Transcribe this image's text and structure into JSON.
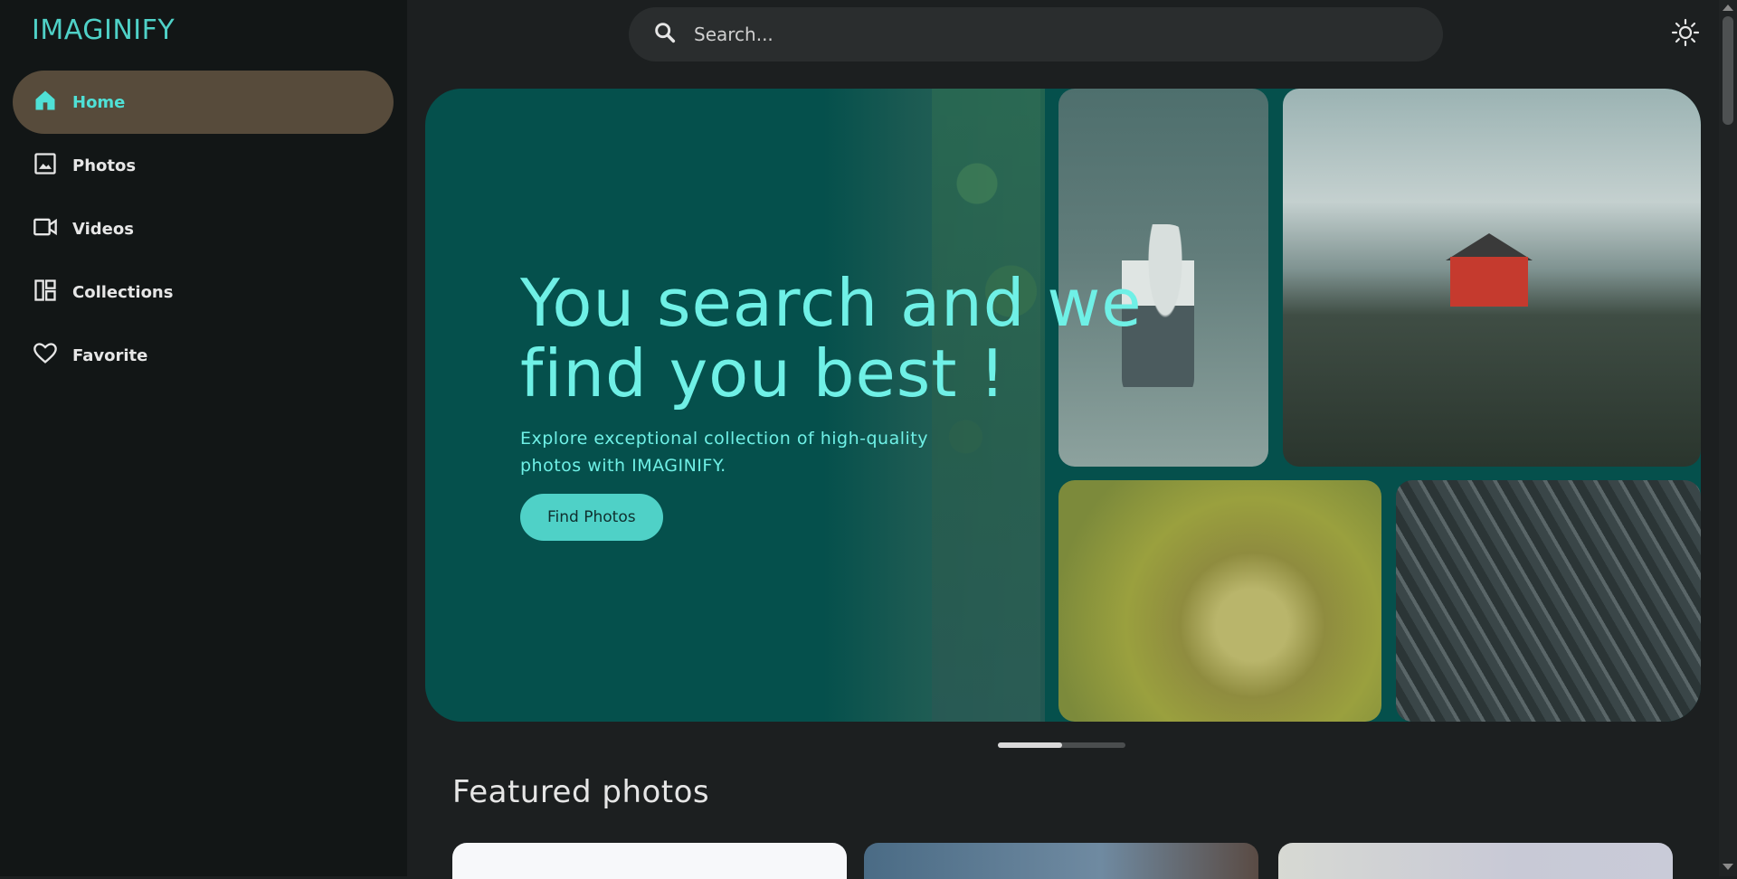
{
  "app": {
    "brand": "IMAGINIFY"
  },
  "sidebar": {
    "items": [
      {
        "label": "Home",
        "icon": "home-icon",
        "active": true
      },
      {
        "label": "Photos",
        "icon": "image-icon",
        "active": false
      },
      {
        "label": "Videos",
        "icon": "video-icon",
        "active": false
      },
      {
        "label": "Collections",
        "icon": "collections-icon",
        "active": false
      },
      {
        "label": "Favorite",
        "icon": "heart-icon",
        "active": false
      }
    ]
  },
  "header": {
    "search_placeholder": "Search...",
    "theme_icon": "sun-icon"
  },
  "hero": {
    "title": "You search and we find you best !",
    "subtitle": "Explore exceptional collection of high-quality photos with IMAGINIFY.",
    "button_label": "Find Photos",
    "slider_progress": 0.5
  },
  "featured": {
    "title": "Featured photos"
  },
  "colors": {
    "accent": "#4fd1c7",
    "hero_bg": "#05504c",
    "active_nav_bg": "#574b3b",
    "sidebar_bg": "#121616",
    "main_bg": "#1c1f20"
  }
}
